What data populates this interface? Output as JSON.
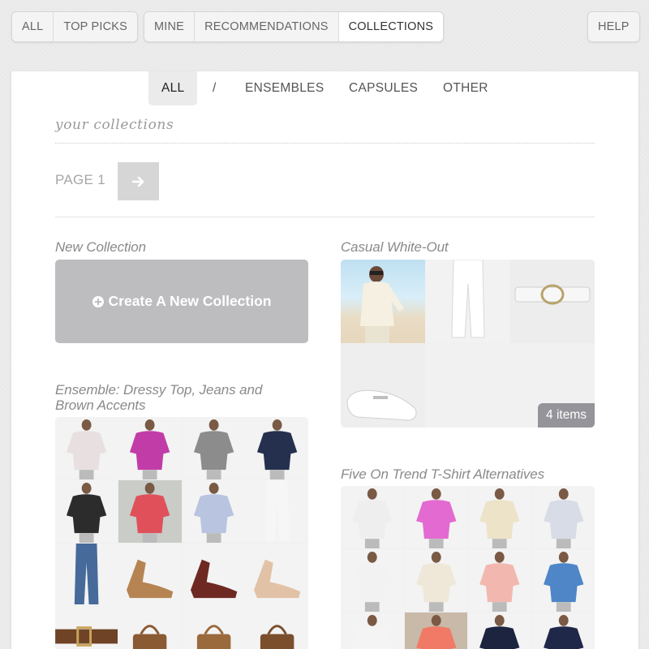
{
  "topnav": {
    "group1": [
      "ALL",
      "TOP PICKS"
    ],
    "group2": [
      "MINE",
      "RECOMMENDATIONS",
      "COLLECTIONS"
    ],
    "help": "HELP"
  },
  "subnav": {
    "all": "ALL",
    "separator": "/",
    "ensembles": "ENSEMBLES",
    "capsules": "CAPSULES",
    "other": "OTHER"
  },
  "heading": "your collections",
  "pagination": {
    "label": "PAGE 1"
  },
  "new_collection": {
    "title": "New Collection",
    "button": "Create A New Collection"
  },
  "collections": [
    {
      "title": "Casual White-Out",
      "badge": "4 items"
    },
    {
      "title": "Ensemble: Dressy Top, Jeans and Brown Accents"
    },
    {
      "title": "Five On Trend T-Shirt Alternatives"
    }
  ],
  "colors": {
    "panel": "#ffffff",
    "background": "#ececec",
    "create_box": "#bdbdc0",
    "badge": "#8c8c92"
  }
}
